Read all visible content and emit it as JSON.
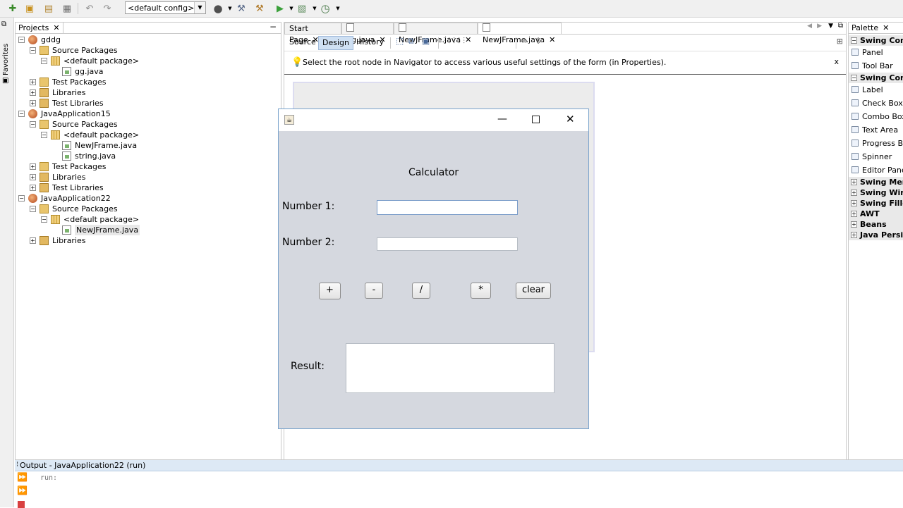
{
  "toolbar": {
    "config_select": "<default config>",
    "icons": [
      "new-file-icon",
      "new-project-icon",
      "open-project-icon",
      "save-all-icon",
      "undo-icon",
      "redo-icon",
      "globe-icon",
      "build-icon",
      "clean-build-icon",
      "run-icon",
      "debug-icon",
      "profile-icon"
    ]
  },
  "left_strip": {
    "label": "Favorites"
  },
  "projects": {
    "tab_label": "Projects",
    "minimize": "−",
    "tree": [
      {
        "label": "gddg",
        "level": 0,
        "icon": "project",
        "exp": "−"
      },
      {
        "label": "Source Packages",
        "level": 1,
        "icon": "pkg",
        "exp": "−"
      },
      {
        "label": "<default package>",
        "level": 2,
        "icon": "pkgd",
        "exp": "−"
      },
      {
        "label": "gg.java",
        "level": 3,
        "icon": "file",
        "exp": ""
      },
      {
        "label": "Test Packages",
        "level": 1,
        "icon": "pkg",
        "exp": "+"
      },
      {
        "label": "Libraries",
        "level": 1,
        "icon": "lib",
        "exp": "+"
      },
      {
        "label": "Test Libraries",
        "level": 1,
        "icon": "lib",
        "exp": "+"
      },
      {
        "label": "JavaApplication15",
        "level": 0,
        "icon": "project",
        "exp": "−"
      },
      {
        "label": "Source Packages",
        "level": 1,
        "icon": "pkg",
        "exp": "−"
      },
      {
        "label": "<default package>",
        "level": 2,
        "icon": "pkgd",
        "exp": "−"
      },
      {
        "label": "NewJFrame.java",
        "level": 3,
        "icon": "file",
        "exp": ""
      },
      {
        "label": "string.java",
        "level": 3,
        "icon": "file",
        "exp": ""
      },
      {
        "label": "Test Packages",
        "level": 1,
        "icon": "pkg",
        "exp": "+"
      },
      {
        "label": "Libraries",
        "level": 1,
        "icon": "lib",
        "exp": "+"
      },
      {
        "label": "Test Libraries",
        "level": 1,
        "icon": "lib",
        "exp": "+"
      },
      {
        "label": "JavaApplication22",
        "level": 0,
        "icon": "project",
        "exp": "−"
      },
      {
        "label": "Source Packages",
        "level": 1,
        "icon": "pkg",
        "exp": "−"
      },
      {
        "label": "<default package>",
        "level": 2,
        "icon": "pkgd",
        "exp": "−"
      },
      {
        "label": "NewJFrame.java",
        "level": 3,
        "icon": "file",
        "exp": "",
        "selected": true
      },
      {
        "label": "Libraries",
        "level": 1,
        "icon": "lib",
        "exp": "+"
      }
    ]
  },
  "editor": {
    "tabs": [
      {
        "label": "Start Page"
      },
      {
        "label": "gg.java"
      },
      {
        "label": "NewJFrame.java"
      },
      {
        "label": "NewJFrame.java",
        "active": true
      }
    ],
    "modes": {
      "source": "Source",
      "design": "Design",
      "history": "History"
    },
    "hint": "Select the root node in Navigator to access various useful settings of the form (in Properties).",
    "hint_close": "x"
  },
  "palette": {
    "tab_label": "Palette",
    "items": [
      {
        "type": "cat",
        "label": "Swing Cont",
        "exp": "−"
      },
      {
        "type": "item",
        "label": "Panel"
      },
      {
        "type": "item",
        "label": "Tool Bar"
      },
      {
        "type": "cat",
        "label": "Swing Cont",
        "exp": "−"
      },
      {
        "type": "item",
        "label": "Label"
      },
      {
        "type": "item",
        "label": "Check Box"
      },
      {
        "type": "item",
        "label": "Combo Box"
      },
      {
        "type": "item",
        "label": "Text Area"
      },
      {
        "type": "item",
        "label": "Progress Bar"
      },
      {
        "type": "item",
        "label": "Spinner"
      },
      {
        "type": "item",
        "label": "Editor Pane"
      },
      {
        "type": "cat",
        "label": "Swing Menu",
        "exp": "+"
      },
      {
        "type": "cat",
        "label": "Swing Wind",
        "exp": "+"
      },
      {
        "type": "cat",
        "label": "Swing Fillers",
        "exp": "+"
      },
      {
        "type": "cat",
        "label": "AWT",
        "exp": "+"
      },
      {
        "type": "cat",
        "label": "Beans",
        "exp": "+"
      },
      {
        "type": "cat",
        "label": "Java Persis",
        "exp": "+"
      }
    ]
  },
  "calculator": {
    "heading": "Calculator",
    "number1_label": "Number 1:",
    "number2_label": "Number 2:",
    "number1_value": "",
    "number2_value": "",
    "buttons": {
      "plus": "+",
      "minus": "-",
      "divide": "/",
      "multiply": "*",
      "clear": "clear"
    },
    "result_label": "Result:",
    "result_value": ""
  },
  "output": {
    "title": "Output - JavaApplication22 (run)",
    "text": "run:"
  }
}
